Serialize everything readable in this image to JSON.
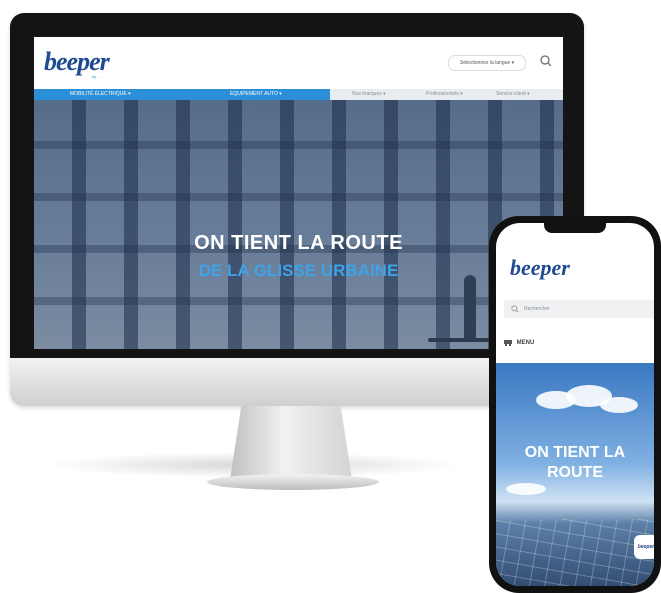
{
  "desktop": {
    "logo": "beeper",
    "logo_sub": "by ...",
    "language": "Sélectionnez la langue ▾",
    "nav": {
      "items": [
        "MOBILITÉ ÉLECTRIQUE ▾",
        "ÉQUIPEMENT AUTO ▾",
        "Nos marques ▾",
        "Professionnels ▾",
        "Service client ▾"
      ]
    },
    "hero": {
      "line1": "ON TIENT LA ROUTE",
      "line2": "DE LA GLISSE URBAINE"
    }
  },
  "phone": {
    "logo": "beeper",
    "search_placeholder": "Rechercher",
    "menu_label": "MENU",
    "hero": {
      "line1": "ON TIENT LA",
      "line2": "ROUTE"
    },
    "badge": "beeper"
  },
  "colors": {
    "brand_blue": "#1e4a8f",
    "accent_blue": "#2a8fd8"
  }
}
